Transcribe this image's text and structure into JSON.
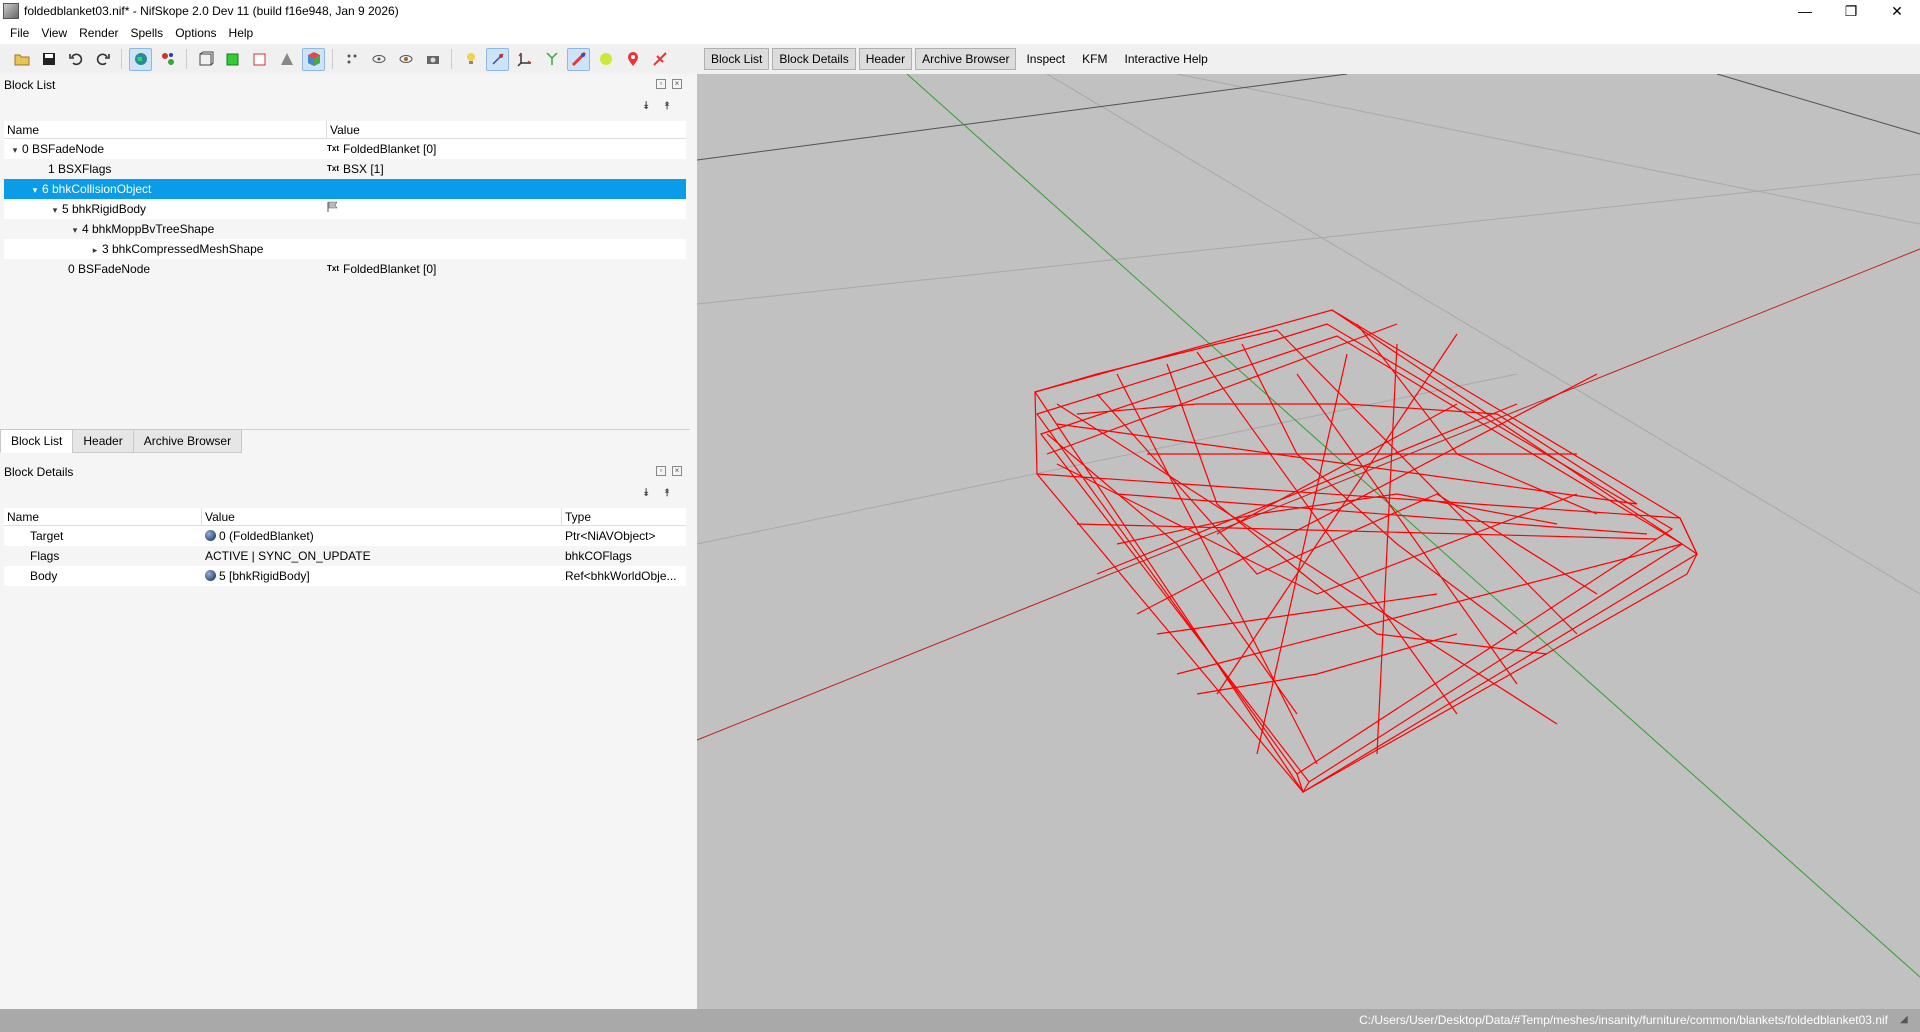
{
  "window": {
    "title": "foldedblanket03.nif* - NifSkope 2.0 Dev 11 (build f16e948, Jan  9 2026)",
    "minimize": "—",
    "maximize": "❐",
    "close": "✕"
  },
  "menu": [
    "File",
    "View",
    "Render",
    "Spells",
    "Options",
    "Help"
  ],
  "view_toolbar": {
    "block_list": "Block List",
    "block_details": "Block Details",
    "header": "Header",
    "archive_browser": "Archive Browser",
    "inspect": "Inspect",
    "kfm": "KFM",
    "interactive_help": "Interactive Help"
  },
  "block_list": {
    "title": "Block List",
    "col_name": "Name",
    "col_value": "Value",
    "rows": [
      {
        "name": "0 BSFadeNode",
        "value": "FoldedBlanket [0]",
        "icon": "Txt",
        "arrow": "▾"
      },
      {
        "name": "1 BSXFlags",
        "value": "BSX [1]",
        "icon": "Txt",
        "arrow": ""
      },
      {
        "name": "6 bhkCollisionObject",
        "value": "",
        "icon": "",
        "arrow": "▾"
      },
      {
        "name": "5 bhkRigidBody",
        "value": "",
        "icon": "flag",
        "arrow": "▾"
      },
      {
        "name": "4 bhkMoppBvTreeShape",
        "value": "",
        "icon": "",
        "arrow": "▾"
      },
      {
        "name": "3 bhkCompressedMeshShape",
        "value": "",
        "icon": "",
        "arrow": "▸"
      },
      {
        "name": "0 BSFadeNode",
        "value": "FoldedBlanket [0]",
        "icon": "Txt",
        "arrow": ""
      }
    ]
  },
  "tabs": [
    "Block List",
    "Header",
    "Archive Browser"
  ],
  "block_details": {
    "title": "Block Details",
    "col_name": "Name",
    "col_value": "Value",
    "col_type": "Type",
    "rows": [
      {
        "name": "Target",
        "value": "0 (FoldedBlanket)",
        "type": "Ptr<NiAVObject>",
        "ref": true
      },
      {
        "name": "Flags",
        "value": "ACTIVE | SYNC_ON_UPDATE",
        "type": "bhkCOFlags",
        "ref": false
      },
      {
        "name": "Body",
        "value": "5 [bhkRigidBody]",
        "type": "Ref<bhkWorldObje...",
        "ref": true
      }
    ]
  },
  "status": {
    "path": "C:/Users/User/Desktop/Data/#Temp/meshes/insanity/furniture/common/blankets/foldedblanket03.nif"
  },
  "colors": {
    "selection": "#0a9ce8",
    "viewport_bg": "#c1c1c1",
    "wireframe": "#ff0000",
    "axis_green": "#2fa02f",
    "axis_red": "#c02020"
  }
}
